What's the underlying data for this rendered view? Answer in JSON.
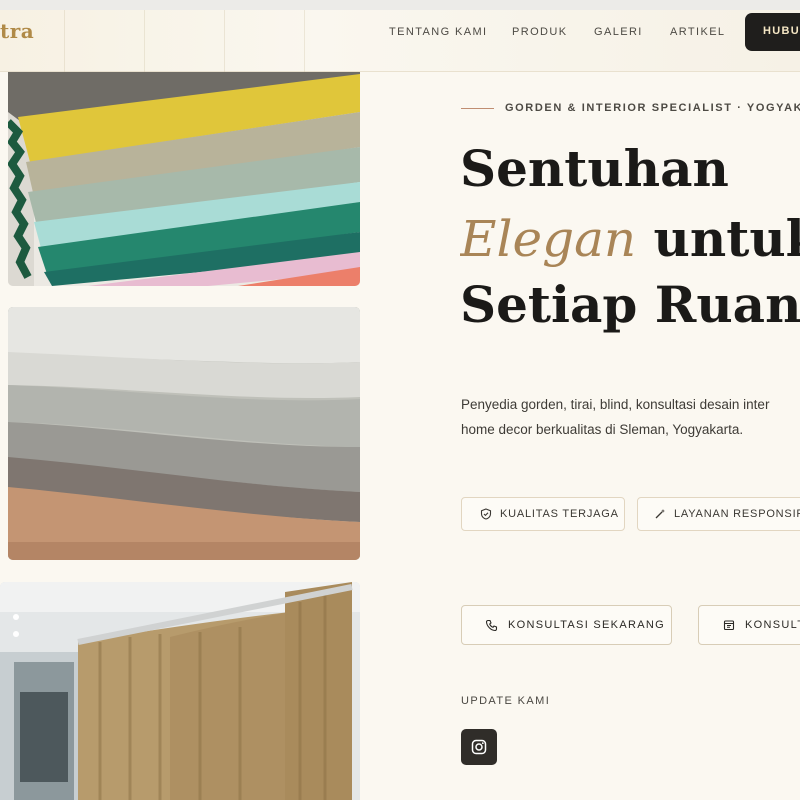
{
  "header": {
    "logo": "tra",
    "nav": [
      "TENTANG KAMI",
      "PRODUK",
      "GALERI",
      "ARTIKEL"
    ],
    "cta": "HUBUN"
  },
  "hero": {
    "eyebrow": "GORDEN & INTERIOR SPECIALIST · YOGYAKA",
    "headline_line1": "Sentuhan",
    "headline_accent": "Elegan",
    "headline_line2_rest": " untuk",
    "headline_line3": "Setiap Ruan",
    "description_line1": "Penyedia gorden, tirai, blind, konsultasi desain inter",
    "description_line2": "home decor berkualitas di Sleman, Yogyakarta.",
    "chips": [
      "KUALITAS TERJAGA",
      "LAYANAN RESPONSIF"
    ],
    "cta_primary": "KONSULTASI SEKARANG",
    "cta_secondary": "KONSULTA",
    "update_label": "UPDATE KAMI"
  },
  "icons": {
    "chip_quality": "shield-check-icon",
    "chip_service": "magic-wand-icon",
    "cta_primary": "phone-icon",
    "cta_secondary": "calendar-icon",
    "social": "instagram-icon"
  },
  "colors": {
    "background": "#fbf8f1",
    "accent_gold": "#b08a47",
    "accent_italic": "#a98557",
    "dark": "#1f1e1c"
  }
}
